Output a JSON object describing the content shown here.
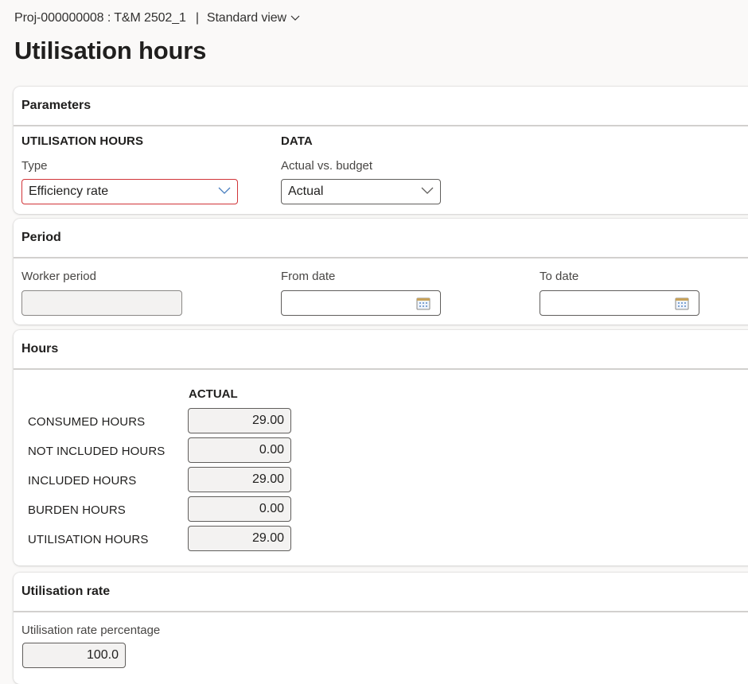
{
  "header": {
    "record": "Proj-000000008 : T&M 2502_1",
    "separator": "|",
    "view": "Standard view",
    "title": "Utilisation hours"
  },
  "parameters": {
    "title": "Parameters",
    "utilisation_group": "UTILISATION HOURS",
    "type_label": "Type",
    "type_value": "Efficiency rate",
    "data_group": "DATA",
    "actual_vs_budget_label": "Actual vs. budget",
    "actual_vs_budget_value": "Actual"
  },
  "period": {
    "title": "Period",
    "worker_period_label": "Worker period",
    "worker_period_value": "",
    "from_date_label": "From date",
    "from_date_value": "",
    "to_date_label": "To date",
    "to_date_value": ""
  },
  "hours": {
    "title": "Hours",
    "column_header": "ACTUAL",
    "rows": [
      {
        "label": "CONSUMED HOURS",
        "value": "29.00"
      },
      {
        "label": "NOT INCLUDED HOURS",
        "value": "0.00"
      },
      {
        "label": "INCLUDED HOURS",
        "value": "29.00"
      },
      {
        "label": "BURDEN HOURS",
        "value": "0.00"
      },
      {
        "label": "UTILISATION HOURS",
        "value": "29.00"
      }
    ]
  },
  "utilisation_rate": {
    "title": "Utilisation rate",
    "percentage_label": "Utilisation rate percentage",
    "percentage_value": "100.0"
  },
  "colors": {
    "error_border": "#d13438",
    "chevron_blue": "#4a7fbf"
  }
}
